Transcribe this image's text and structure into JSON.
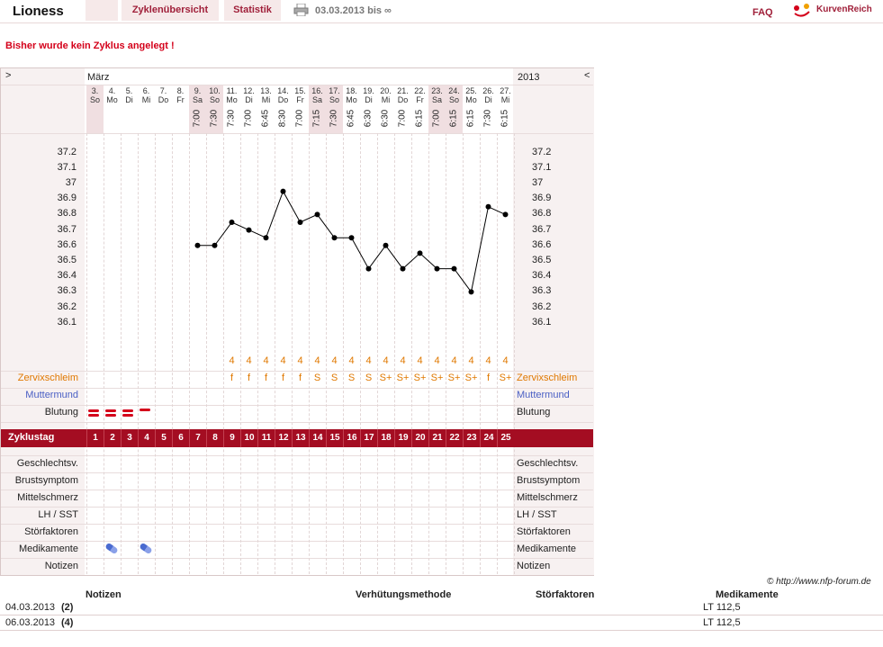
{
  "header": {
    "app_name": "Lioness",
    "tabs": [
      "",
      "Zyklenübersicht",
      "Statistik"
    ],
    "date_range": "03.03.2013 bis ∞",
    "faq": "FAQ",
    "brand": "KurvenReich"
  },
  "warning": "Bisher wurde kein Zyklus angelegt !",
  "chart_nav": {
    "prev": ">",
    "next": "<",
    "month": "März",
    "year": "2013"
  },
  "days": [
    {
      "d": "3.",
      "w": "So",
      "t": ""
    },
    {
      "d": "4.",
      "w": "Mo",
      "t": ""
    },
    {
      "d": "5.",
      "w": "Di",
      "t": ""
    },
    {
      "d": "6.",
      "w": "Mi",
      "t": ""
    },
    {
      "d": "7.",
      "w": "Do",
      "t": ""
    },
    {
      "d": "8.",
      "w": "Fr",
      "t": ""
    },
    {
      "d": "9.",
      "w": "Sa",
      "t": "7:00"
    },
    {
      "d": "10.",
      "w": "So",
      "t": "7:30"
    },
    {
      "d": "11.",
      "w": "Mo",
      "t": "7:30"
    },
    {
      "d": "12.",
      "w": "Di",
      "t": "7:00"
    },
    {
      "d": "13.",
      "w": "Mi",
      "t": "6:45"
    },
    {
      "d": "14.",
      "w": "Do",
      "t": "8:30"
    },
    {
      "d": "15.",
      "w": "Fr",
      "t": "7:00"
    },
    {
      "d": "16.",
      "w": "Sa",
      "t": "7:15"
    },
    {
      "d": "17.",
      "w": "So",
      "t": "7:30"
    },
    {
      "d": "18.",
      "w": "Mo",
      "t": "6:45"
    },
    {
      "d": "19.",
      "w": "Di",
      "t": "6:30"
    },
    {
      "d": "20.",
      "w": "Mi",
      "t": "6:30"
    },
    {
      "d": "21.",
      "w": "Do",
      "t": "7:00"
    },
    {
      "d": "22.",
      "w": "Fr",
      "t": "6:15"
    },
    {
      "d": "23.",
      "w": "Sa",
      "t": "7:00"
    },
    {
      "d": "24.",
      "w": "So",
      "t": "6:15"
    },
    {
      "d": "25.",
      "w": "Mo",
      "t": "6:15"
    },
    {
      "d": "26.",
      "w": "Di",
      "t": "7:30"
    },
    {
      "d": "27.",
      "w": "Mi",
      "t": "6:15"
    }
  ],
  "temp_axis": [
    "37.2",
    "37.1",
    "37",
    "36.9",
    "36.8",
    "36.7",
    "36.6",
    "36.5",
    "36.4",
    "36.3",
    "36.2",
    "36.1"
  ],
  "chart_data": {
    "type": "line",
    "x": [
      "3.",
      "4.",
      "5.",
      "6.",
      "7.",
      "8.",
      "9.",
      "10.",
      "11.",
      "12.",
      "13.",
      "14.",
      "15.",
      "16.",
      "17.",
      "18.",
      "19.",
      "20.",
      "21.",
      "22.",
      "23.",
      "24.",
      "25.",
      "26.",
      "27."
    ],
    "values": [
      null,
      null,
      null,
      null,
      null,
      null,
      36.6,
      36.6,
      36.75,
      36.7,
      36.65,
      36.95,
      36.75,
      36.8,
      36.65,
      36.65,
      36.45,
      36.6,
      36.45,
      36.55,
      36.45,
      36.45,
      36.3,
      36.85,
      36.8
    ],
    "ylim": [
      36.0,
      37.25
    ]
  },
  "cervix_feel": [
    "",
    "",
    "",
    "",
    "",
    "",
    "",
    "",
    "4",
    "4",
    "4",
    "4",
    "4",
    "4",
    "4",
    "4",
    "4",
    "4",
    "4",
    "4",
    "4",
    "4",
    "4",
    "4",
    "4"
  ],
  "cervix_mucus": [
    "",
    "",
    "",
    "",
    "",
    "",
    "",
    "",
    "f",
    "f",
    "f",
    "f",
    "f",
    "S",
    "S",
    "S",
    "S",
    "S+",
    "S+",
    "S+",
    "S+",
    "S+",
    "S+",
    "f",
    "S+"
  ],
  "rows_left": {
    "zervix": "Zervixschleim",
    "muttermund": "Muttermund",
    "blutung": "Blutung",
    "zyklustag": "Zyklustag",
    "geschlecht": "Geschlechtsv.",
    "brust": "Brustsymptom",
    "mittel": "Mittelschmerz",
    "lh": "LH / SST",
    "stoer": "Störfaktoren",
    "medi": "Medikamente",
    "notizen": "Notizen"
  },
  "cycle_days": [
    "1",
    "2",
    "3",
    "4",
    "5",
    "6",
    "7",
    "8",
    "9",
    "10",
    "11",
    "12",
    "13",
    "14",
    "15",
    "16",
    "17",
    "18",
    "19",
    "20",
    "21",
    "22",
    "23",
    "24",
    "25"
  ],
  "copyright": "© http://www.nfp-forum.de",
  "table": {
    "headers": [
      "Notizen",
      "Verhütungsmethode",
      "Störfaktoren",
      "Medikamente"
    ],
    "rows": [
      {
        "date": "04.03.2013",
        "num": "(2)",
        "med": "LT 112,5"
      },
      {
        "date": "06.03.2013",
        "num": "(4)",
        "med": "LT 112,5"
      }
    ]
  }
}
